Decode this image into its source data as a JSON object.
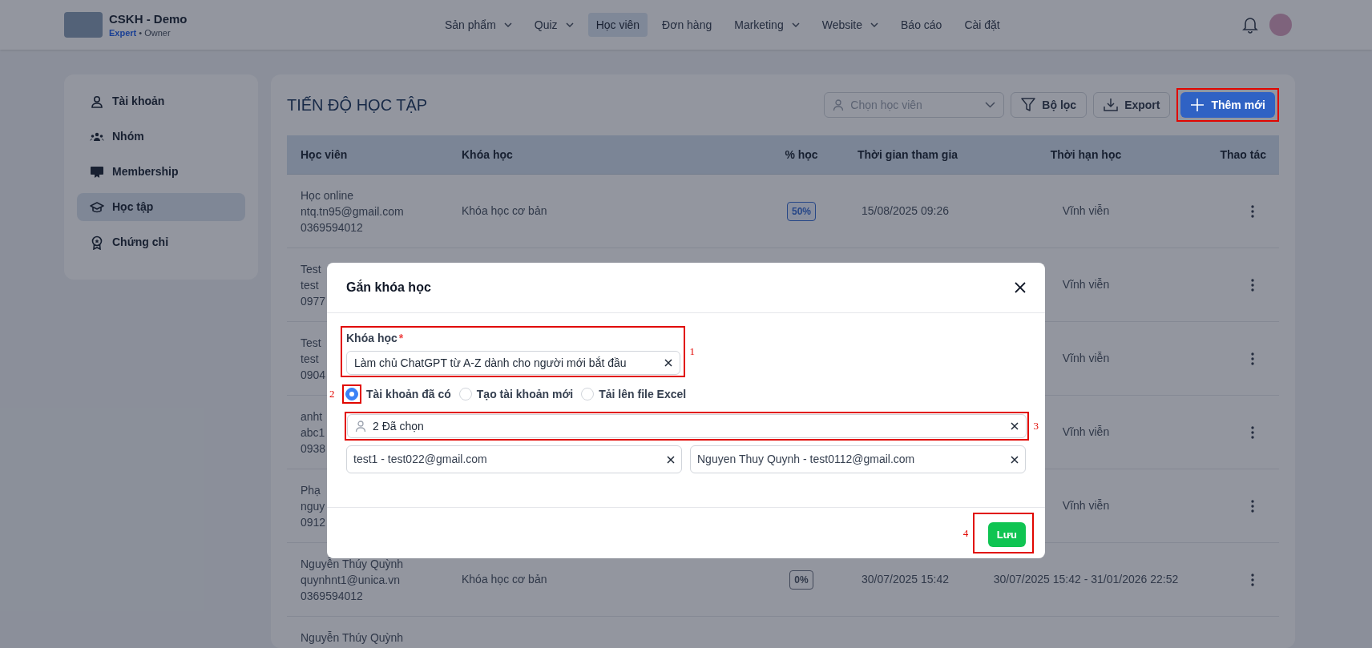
{
  "header": {
    "brand": {
      "title": "CSKH - Demo",
      "plan": "Expert",
      "role": "• Owner"
    },
    "nav": [
      {
        "label": "Sản phẩm",
        "dropdown": true,
        "selected": false
      },
      {
        "label": "Quiz",
        "dropdown": true,
        "selected": false
      },
      {
        "label": "Học viên",
        "dropdown": false,
        "selected": true
      },
      {
        "label": "Đơn hàng",
        "dropdown": false,
        "selected": false
      },
      {
        "label": "Marketing",
        "dropdown": true,
        "selected": false
      },
      {
        "label": "Website",
        "dropdown": true,
        "selected": false
      },
      {
        "label": "Báo cáo",
        "dropdown": false,
        "selected": false
      },
      {
        "label": "Cài đặt",
        "dropdown": false,
        "selected": false
      }
    ]
  },
  "sidebar": {
    "items": [
      {
        "label": "Tài khoản",
        "selected": false
      },
      {
        "label": "Nhóm",
        "selected": false
      },
      {
        "label": "Membership",
        "selected": false
      },
      {
        "label": "Học tập",
        "selected": true
      },
      {
        "label": "Chứng chỉ",
        "selected": false
      }
    ]
  },
  "page": {
    "title": "TIẾN ĐỘ HỌC TẬP",
    "student_filter": {
      "placeholder": "Chọn học viên"
    },
    "buttons": [
      {
        "label": "Bộ lọc",
        "kind": "filter",
        "highlighted": false
      },
      {
        "label": "Export",
        "kind": "export",
        "highlighted": false
      },
      {
        "label": "Thêm mới",
        "kind": "add",
        "highlighted": true
      }
    ]
  },
  "table": {
    "columns": [
      "Học viên",
      "Khóa học",
      "% học",
      "Thời gian tham gia",
      "Thời hạn học",
      "Thao tác"
    ],
    "rows": [
      {
        "student": [
          "Học online",
          "ntq.tn95@gmail.com",
          "0369594012"
        ],
        "course": "Khóa học cơ bản",
        "percent": {
          "text": "50%",
          "kind": "progress"
        },
        "joined": "15/08/2025 09:26",
        "duration": "Vĩnh viễn"
      },
      {
        "student": [
          "Test",
          "test",
          "0977"
        ],
        "duration": "Vĩnh viễn"
      },
      {
        "student": [
          "Test",
          "test",
          "0904"
        ],
        "duration": "Vĩnh viễn"
      },
      {
        "student": [
          "anht",
          "abc1",
          "0938"
        ],
        "duration": "Vĩnh viễn"
      },
      {
        "student": [
          "Phạ",
          "nguy",
          "0912"
        ],
        "duration": "Vĩnh viễn"
      },
      {
        "student": [
          "Nguyễn Thúy Quỳnh",
          "quynhnt1@unica.vn",
          "0369594012"
        ],
        "course": "Khóa học cơ bản",
        "percent": {
          "text": "0%",
          "kind": "none"
        },
        "joined": "30/07/2025 15:42",
        "duration": "30/07/2025 15:42 - 31/01/2026 22:52"
      },
      {
        "student": [
          "Nguyễn Thúy Quỳnh"
        ]
      }
    ]
  },
  "modal": {
    "title": "Gắn khóa học",
    "course": {
      "label": "Khóa học",
      "required_mark": "*",
      "value": "Làm chủ ChatGPT từ A-Z dành cho người mới bắt đầu",
      "annotation": "1"
    },
    "account_options": [
      {
        "label": "Tài khoản đã có",
        "selected": true,
        "annotation": "2"
      },
      {
        "label": "Tạo tài khoản mới",
        "selected": false
      },
      {
        "label": "Tải lên file Excel",
        "selected": false
      }
    ],
    "students": {
      "value": "2 Đã chọn",
      "annotation": "3"
    },
    "selected_students": [
      "test1 - test022@gmail.com",
      "Nguyen Thuy Quynh - test0112@gmail.com"
    ],
    "save_button": {
      "label": "Lưu",
      "annotation": "4"
    }
  }
}
